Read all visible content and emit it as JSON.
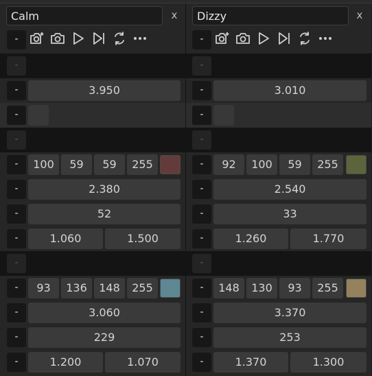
{
  "panels": [
    {
      "name": "Calm",
      "close_label": "x",
      "toolbar_minus": "-",
      "row_minus": "-",
      "value_a": "3.950",
      "color1": {
        "r": "100",
        "g": "59",
        "b": "59",
        "a": "255",
        "swatch": "#643b3b"
      },
      "value_b": "2.380",
      "value_c": "52",
      "pair1": [
        "1.060",
        "1.500"
      ],
      "color2": {
        "r": "93",
        "g": "136",
        "b": "148",
        "a": "255",
        "swatch": "#5d8894"
      },
      "value_d": "3.060",
      "value_e": "229",
      "pair2": [
        "1.200",
        "1.070"
      ]
    },
    {
      "name": "Dizzy",
      "close_label": "x",
      "toolbar_minus": "-",
      "row_minus": "-",
      "value_a": "3.010",
      "color1": {
        "r": "92",
        "g": "100",
        "b": "59",
        "a": "255",
        "swatch": "#5c643b"
      },
      "value_b": "2.540",
      "value_c": "33",
      "pair1": [
        "1.260",
        "1.770"
      ],
      "color2": {
        "r": "148",
        "g": "130",
        "b": "93",
        "a": "255",
        "swatch": "#94825d"
      },
      "value_d": "3.370",
      "value_e": "253",
      "pair2": [
        "1.370",
        "1.300"
      ]
    }
  ],
  "toolbar_icons": [
    "add-photo-icon",
    "camera-icon",
    "play-icon",
    "skip-forward-icon",
    "refresh-icon",
    "more-icon"
  ]
}
